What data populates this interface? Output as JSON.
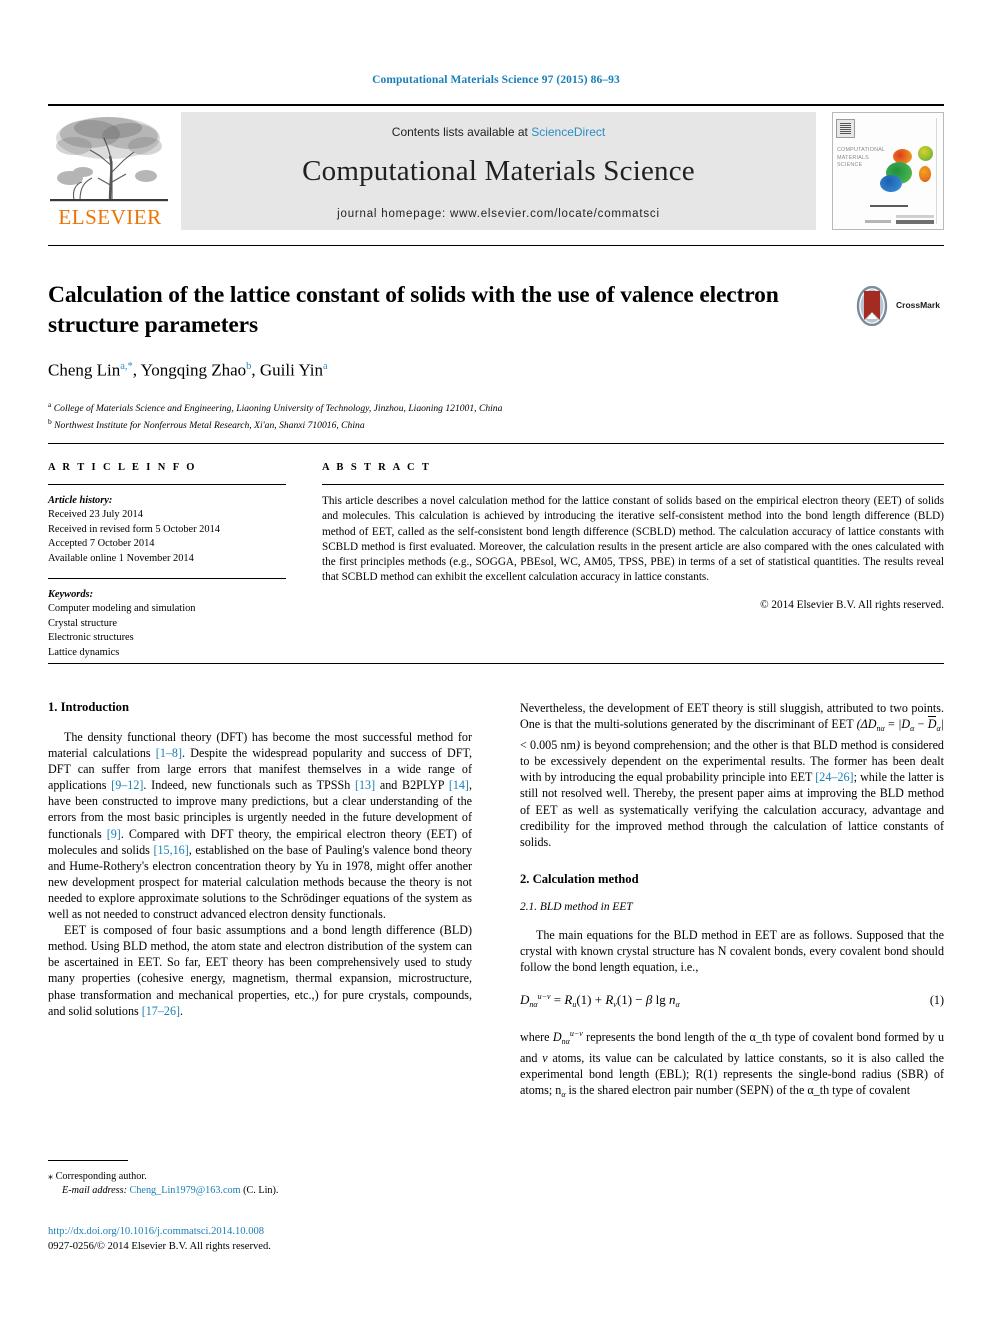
{
  "running_head": "Computational Materials Science 97 (2015) 86–93",
  "masthead": {
    "contents_prefix": "Contents lists available at ",
    "sciencedirect": "ScienceDirect",
    "journal_title": "Computational Materials Science",
    "homepage": "journal homepage: www.elsevier.com/locate/commatsci",
    "publisher_wordmark": "ELSEVIER",
    "cover_title": "COMPUTATIONAL MATERIALS SCIENCE",
    "accent_link_color": "#2a8ec4",
    "elsevier_orange": "#ec7404"
  },
  "article": {
    "title": "Calculation of the lattice constant of solids with the use of valence electron structure parameters",
    "authors_html": "Cheng Lin, Yongqing Zhao, Guili Yin",
    "author_list": [
      {
        "name": "Cheng Lin",
        "marks": "a,*"
      },
      {
        "name": "Yongqing Zhao",
        "marks": "b"
      },
      {
        "name": "Guili Yin",
        "marks": "a"
      }
    ],
    "affiliations": [
      {
        "mark": "a",
        "text": "College of Materials Science and Engineering, Liaoning University of Technology, Jinzhou, Liaoning 121001, China"
      },
      {
        "mark": "b",
        "text": "Northwest Institute for Nonferrous Metal Research, Xi'an, Shanxi 710016, China"
      }
    ],
    "crossmark_label": "CrossMark"
  },
  "article_info": {
    "heading": "A R T I C L E  I N F O",
    "history_title": "Article history:",
    "history": [
      "Received 23 July 2014",
      "Received in revised form 5 October 2014",
      "Accepted 7 October 2014",
      "Available online 1 November 2014"
    ],
    "keywords_title": "Keywords:",
    "keywords": [
      "Computer modeling and simulation",
      "Crystal structure",
      "Electronic structures",
      "Lattice dynamics"
    ]
  },
  "abstract": {
    "heading": "A B S T R A C T",
    "text": "This article describes a novel calculation method for the lattice constant of solids based on the empirical electron theory (EET) of solids and molecules. This calculation is achieved by introducing the iterative self-consistent method into the bond length difference (BLD) method of EET, called as the self-consistent bond length difference (SCBLD) method. The calculation accuracy of lattice constants with SCBLD method is first evaluated. Moreover, the calculation results in the present article are also compared with the ones calculated with the first principles methods (e.g., SOGGA, PBEsol, WC, AM05, TPSS, PBE) in terms of a set of statistical quantities. The results reveal that SCBLD method can exhibit the excellent calculation accuracy in lattice constants.",
    "copyright": "© 2014 Elsevier B.V. All rights reserved."
  },
  "body": {
    "section1_heading": "1. Introduction",
    "section2_heading": "2. Calculation method",
    "subsection21_heading": "2.1. BLD method in EET",
    "p1_a": "The density functional theory (DFT) has become the most successful method for material calculations ",
    "p1_cite1": "[1–8]",
    "p1_b": ". Despite the widespread popularity and success of DFT, DFT can suffer from large errors that manifest themselves in a wide range of applications ",
    "p1_cite2": "[9–12]",
    "p1_c": ". Indeed, new functionals such as TPSSh ",
    "p1_cite3": "[13]",
    "p1_d": " and B2PLYP ",
    "p1_cite4": "[14]",
    "p1_e": ", have been constructed to improve many predictions, but a clear understanding of the errors from the most basic principles is urgently needed in the future development of functionals ",
    "p1_cite5": "[9]",
    "p1_f": ". Compared with DFT theory, the empirical electron theory (EET) of molecules and solids ",
    "p1_cite6": "[15,16]",
    "p1_g": ", established on the base of Pauling's valence bond theory and Hume-Rothery's electron concentration theory by Yu in 1978, might offer another new development prospect for material calculation methods because the theory is not needed to explore approximate solutions to the Schrödinger equations of the system as well as not needed to construct advanced electron density functionals.",
    "p2_a": "EET is composed of four basic assumptions and a bond length difference (BLD) method. Using BLD method, the atom state and electron distribution of the system can be ascertained in EET. So far, EET theory has been comprehensively used to study many properties (cohesive energy, magnetism, thermal expansion, microstructure, phase transformation and mechanical properties, etc.,) for pure crystals, compounds, and solid solutions ",
    "p2_cite1": "[17–26]",
    "p2_b": ".",
    "p3_a": "Nevertheless, the development of EET theory is still sluggish, attributed to two points. One is that the multi-solutions generated by the discriminant of EET ",
    "p3_math": "(ΔD",
    "p3_b": " is beyond comprehension; and the other is that BLD method is considered to be excessively dependent on the experimental results. The former has been dealt with by introducing the equal probability principle into EET ",
    "p3_cite1": "[24–26]",
    "p3_c": "; while the latter is still not resolved well. Thereby, the present paper aims at improving the BLD method of EET as well as systematically verifying the calculation accuracy, advantage and credibility for the improved method through the calculation of lattice constants of solids.",
    "p4_a": "The main equations for the BLD method in EET are as follows. Supposed that the crystal with known crystal structure has N covalent bonds, every covalent bond should follow the bond length equation, i.e.,",
    "eq1_number": "(1)",
    "p5_a": " represents the bond length of the α_th type of covalent bond formed by u and ",
    "p5_b": " atoms, its value can be calculated by lattice constants, so it is also called the experimental bond length (EBL); R(1) represents the single-bond radius (SBR) of atoms; n",
    "p5_c": " is the shared electron pair number (SEPN) of the α_th type of covalent"
  },
  "footnote": {
    "corresponding": "Corresponding author.",
    "email_label": "E-mail address:",
    "email": "Cheng_Lin1979@163.com",
    "email_suffix": "(C. Lin)."
  },
  "imprint": {
    "doi": "http://dx.doi.org/10.1016/j.commatsci.2014.10.008",
    "issn_line": "0927-0256/© 2014 Elsevier B.V. All rights reserved."
  }
}
